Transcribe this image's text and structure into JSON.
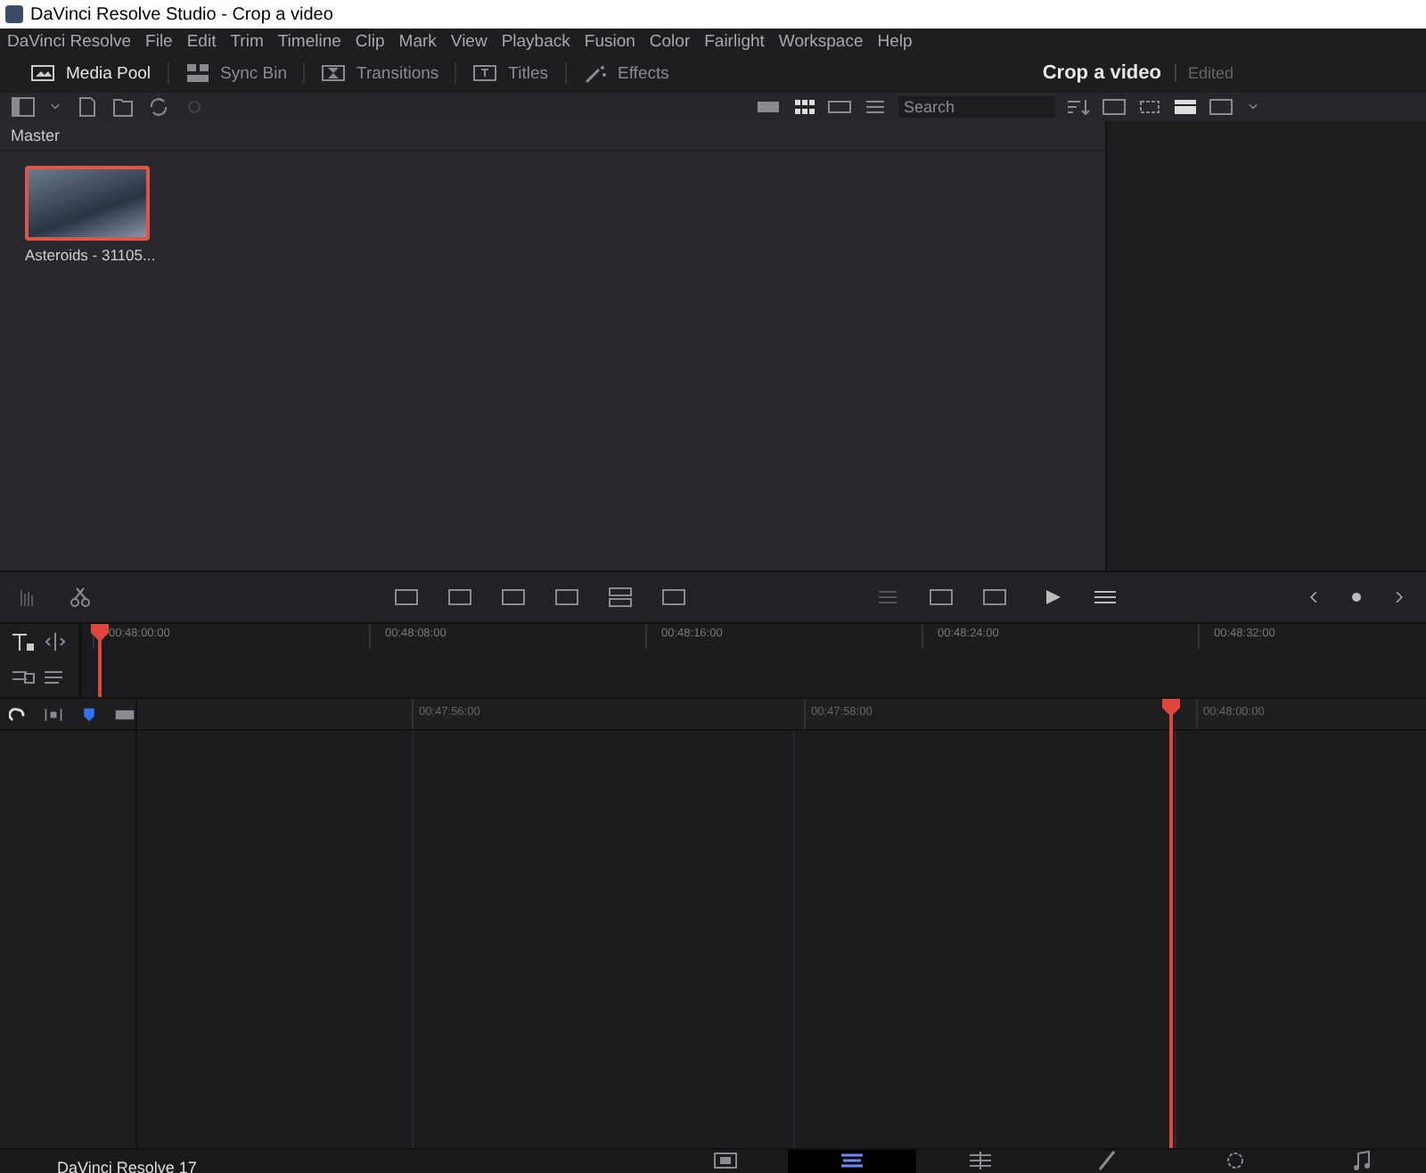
{
  "window": {
    "title": "DaVinci Resolve Studio - Crop a video"
  },
  "menu": [
    "DaVinci Resolve",
    "File",
    "Edit",
    "Trim",
    "Timeline",
    "Clip",
    "Mark",
    "View",
    "Playback",
    "Fusion",
    "Color",
    "Fairlight",
    "Workspace",
    "Help"
  ],
  "toolbar": {
    "buttons": [
      {
        "label": "Media Pool",
        "selected": true
      },
      {
        "label": "Sync Bin",
        "selected": false
      },
      {
        "label": "Transitions",
        "selected": false
      },
      {
        "label": "Titles",
        "selected": false
      },
      {
        "label": "Effects",
        "selected": false
      }
    ],
    "project_title": "Crop a video",
    "project_status": "Edited"
  },
  "search": {
    "placeholder": "Search"
  },
  "bin": {
    "name": "Master"
  },
  "clips": [
    {
      "name": "Asteroids - 31105...",
      "selected": true
    }
  ],
  "upper_ruler": [
    "00:48:00:00",
    "00:48:08:00",
    "00:48:16:00",
    "00:48:24:00",
    "00:48:32:00"
  ],
  "lower_ruler": [
    "00:47:56:00",
    "00:47:58:00",
    "00:48:00:00"
  ],
  "page_tabs": [
    {
      "kind": "media",
      "selected": false
    },
    {
      "kind": "cut",
      "selected": true
    },
    {
      "kind": "edit",
      "selected": false
    },
    {
      "kind": "fusion",
      "selected": false
    },
    {
      "kind": "color",
      "selected": false
    },
    {
      "kind": "fairlight",
      "selected": false
    }
  ],
  "status": "DaVinci Resolve 17"
}
